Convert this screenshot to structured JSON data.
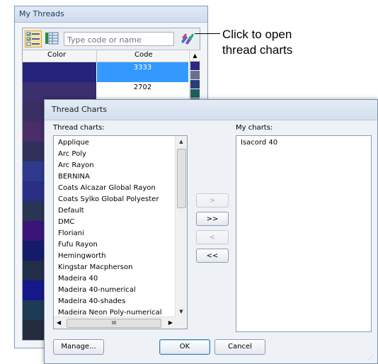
{
  "threads_panel": {
    "title": "My Threads",
    "search_placeholder": "Type code or name",
    "columns": [
      "Color",
      "Code"
    ],
    "rows": [
      {
        "color": "#25237a",
        "code": "3333",
        "selected": true
      },
      {
        "color": "#3b2f6e",
        "code": "2702",
        "selected": false
      },
      {
        "color": "#3a2e62",
        "code": "",
        "selected": false
      },
      {
        "color": "#4b2d6a",
        "code": "",
        "selected": false
      },
      {
        "color": "#30305a",
        "code": "",
        "selected": false
      },
      {
        "color": "#2f3a8e",
        "code": "",
        "selected": false
      },
      {
        "color": "#2a2e85",
        "code": "",
        "selected": false
      },
      {
        "color": "#2a3554",
        "code": "",
        "selected": false
      },
      {
        "color": "#3c1478",
        "code": "",
        "selected": false
      },
      {
        "color": "#141b6a",
        "code": "",
        "selected": false
      },
      {
        "color": "#232d48",
        "code": "",
        "selected": false
      },
      {
        "color": "#16178a",
        "code": "",
        "selected": false
      },
      {
        "color": "#1d3a56",
        "code": "",
        "selected": false
      },
      {
        "color": "#242c3f",
        "code": "",
        "selected": false
      }
    ],
    "mini_swatches": [
      "#2a2880",
      "#6a6f8a",
      "#283c7a",
      "#1d5f5a",
      "#3a4a90",
      "#2a3a6a",
      "#1f5c6a",
      "#3b3f7a",
      "#21507a",
      "#2c2c60",
      "#5a5a7a",
      "#1c3a5a",
      "#36407a",
      "#205a66",
      "#2b2b55",
      "#1f4060",
      "#2f3570",
      "#1e5a5a",
      "#283058",
      "#30366e",
      "#1e4660",
      "#2a2d5e",
      "#3d4a80",
      "#1c3450",
      "#2d3066",
      "#205060",
      "#282c58",
      "#343c72",
      "#1e4a5c",
      "#2a2f62"
    ]
  },
  "callout": {
    "line1": "Click to open",
    "line2": "thread charts"
  },
  "dialog": {
    "title": "Thread Charts",
    "left_label": "Thread charts:",
    "right_label": "My charts:",
    "thread_charts": [
      "Applique",
      "Arc Poly",
      "Arc Rayon",
      "BERNINA",
      "Coats Alcazar Global Rayon",
      "Coats Sylko Global Polyester",
      "Default",
      "DMC",
      "Floriani",
      "Fufu Rayon",
      "Hemingworth",
      "Kingstar Macpherson",
      "Madeira 40",
      "Madeira 40-numerical",
      "Madeira 40-shades",
      "Madeira Neon Poly-numerical"
    ],
    "my_charts": [
      "Isacord 40"
    ],
    "add_one": ">",
    "add_all": ">>",
    "remove_one": "<",
    "remove_all": "<<",
    "manage": "Manage...",
    "ok": "OK",
    "cancel": "Cancel",
    "hscroll_grip": "III"
  }
}
